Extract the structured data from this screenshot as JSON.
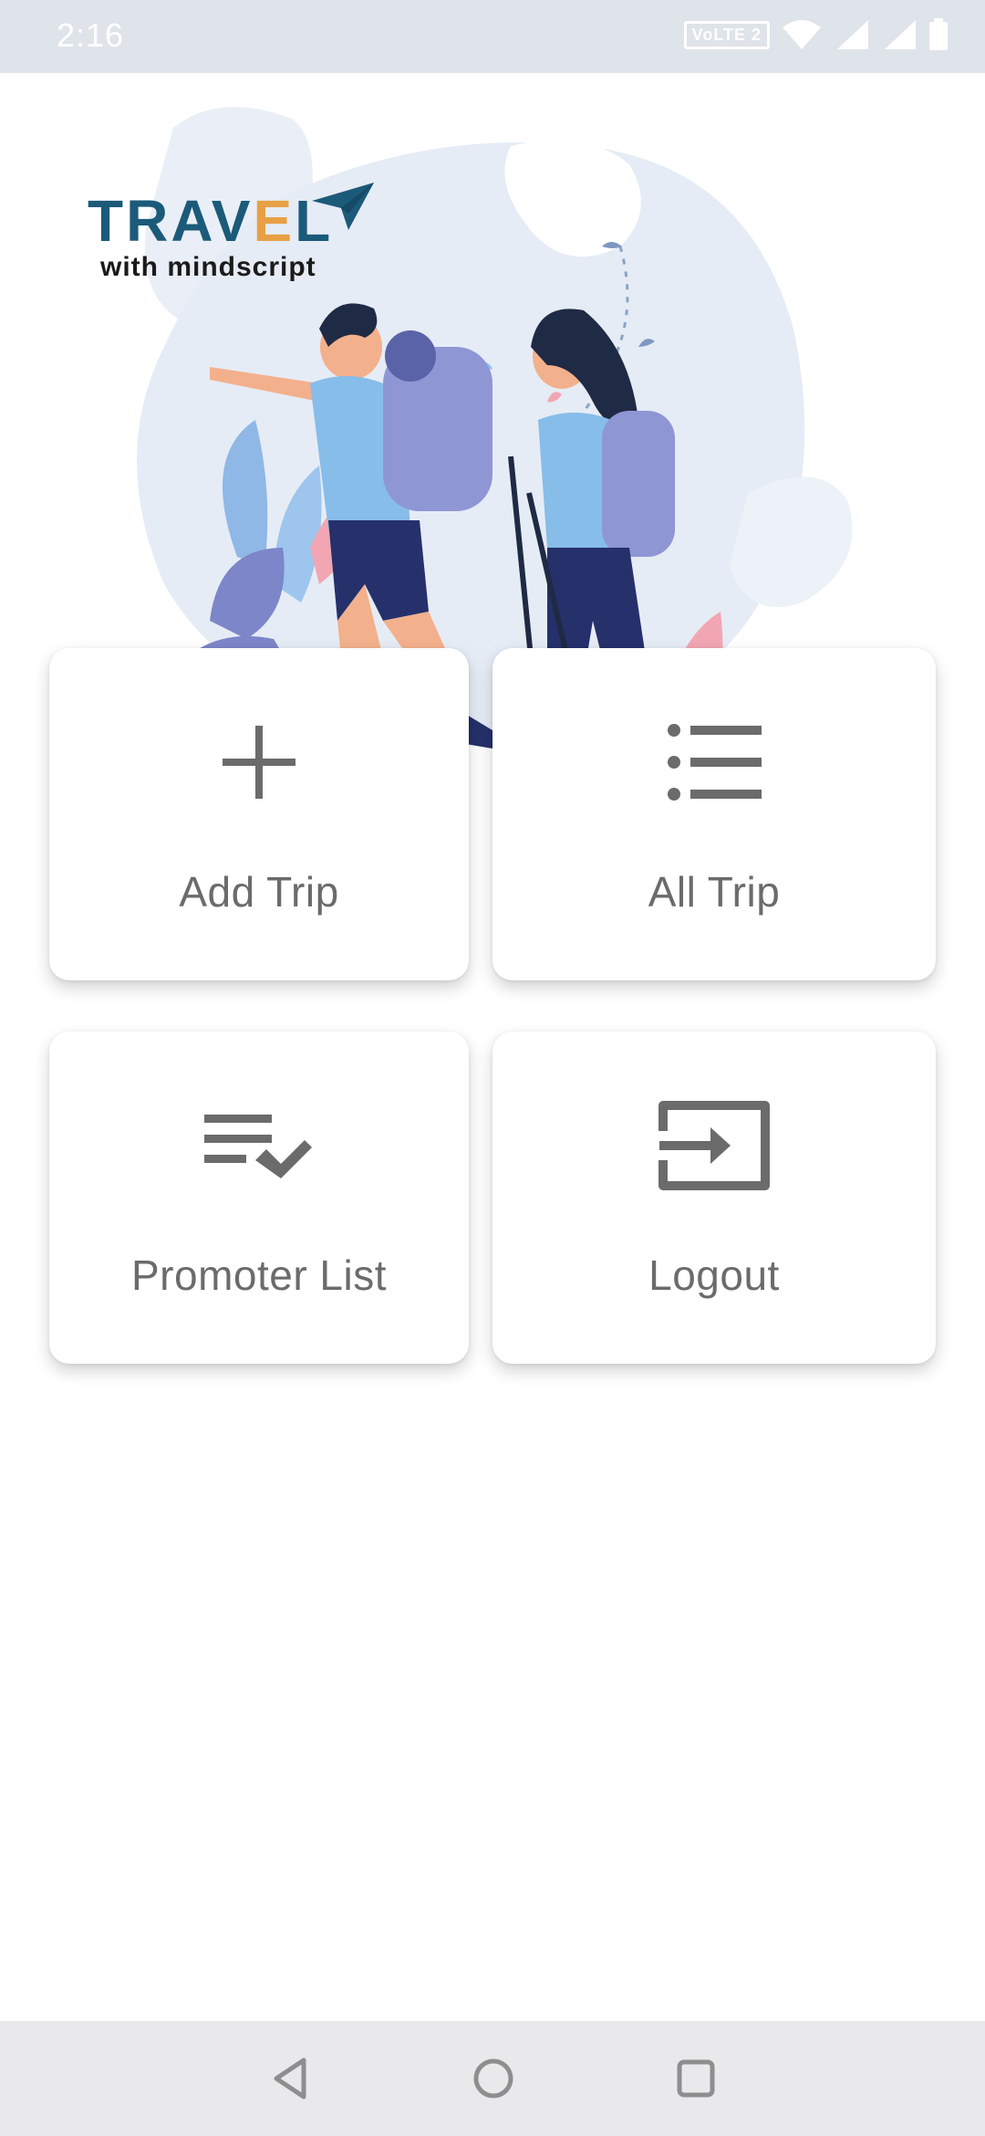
{
  "status_bar": {
    "time": "2:16",
    "network_label": "VoLTE 2",
    "icons": [
      "wifi-icon",
      "signal-icon",
      "signal-icon",
      "battery-icon"
    ]
  },
  "hero": {
    "logo": {
      "main_text": "TRAVEL",
      "sub_text": "with mindscript"
    },
    "illustration": "hikers-illustration"
  },
  "tiles": [
    {
      "label": "Add Trip",
      "icon": "plus-icon"
    },
    {
      "label": "All Trip",
      "icon": "list-icon"
    },
    {
      "label": "Promoter List",
      "icon": "playlist-check-icon"
    },
    {
      "label": "Logout",
      "icon": "logout-icon"
    }
  ],
  "colors": {
    "status_bar": "#dfe3ea",
    "logo_primary": "#1c5a7a",
    "logo_accent": "#e8a045",
    "icon": "#6b6b6b",
    "label": "#6b6b6b",
    "nav_bar": "#e9e9ec"
  }
}
